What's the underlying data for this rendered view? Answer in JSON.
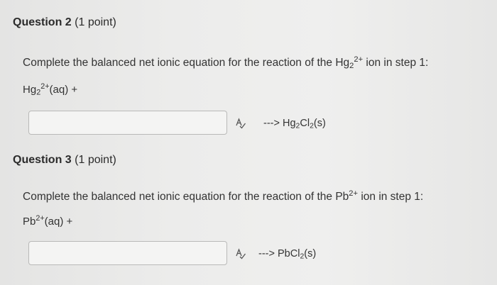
{
  "question2": {
    "number": "Question 2",
    "points": "(1 point)",
    "prompt_text": "Complete the balanced net ionic equation for the reaction of the Hg",
    "prompt_sub": "2",
    "prompt_sup": "2+",
    "prompt_tail": " ion in step 1:",
    "reactant_main": "Hg",
    "reactant_sub": "2",
    "reactant_sup": "2+",
    "reactant_tail": "(aq) +",
    "answer_value": "",
    "arrow": "--->",
    "product_a": "Hg",
    "product_a_sub": "2",
    "product_b": "Cl",
    "product_b_sub": "2",
    "product_tail": "(s)"
  },
  "question3": {
    "number": "Question 3",
    "points": "(1 point)",
    "prompt_text": "Complete the balanced net ionic equation for the reaction of the Pb",
    "prompt_sup": "2+",
    "prompt_tail": " ion in step 1:",
    "reactant_main": "Pb",
    "reactant_sup": "2+",
    "reactant_tail": "(aq) +",
    "answer_value": "",
    "arrow": "--->",
    "product_a": "PbCl",
    "product_a_sub": "2",
    "product_tail": "(s)"
  },
  "icons": {
    "spell_check": "spell-check-icon"
  }
}
